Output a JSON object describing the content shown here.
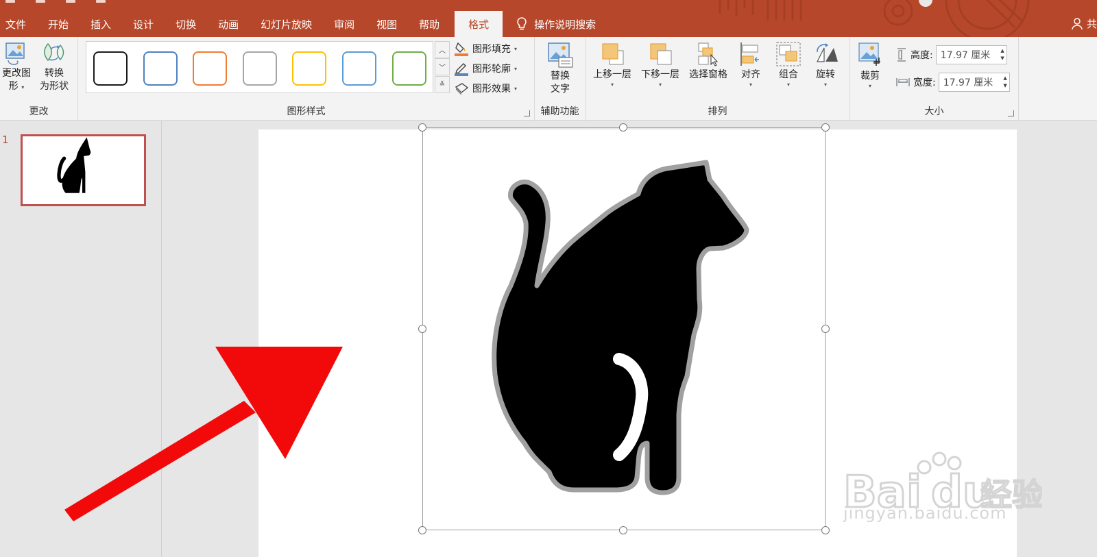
{
  "tabs": [
    "文件",
    "开始",
    "插入",
    "设计",
    "切换",
    "动画",
    "幻灯片放映",
    "审阅",
    "视图",
    "帮助",
    "格式"
  ],
  "active_tab": "格式",
  "tellme": {
    "label": "操作说明搜索"
  },
  "share": {
    "label": "共"
  },
  "ribbon": {
    "change_group": {
      "label": "更改",
      "change_shape": {
        "line1": "更改图",
        "line2": "形"
      },
      "convert": {
        "line1": "转换",
        "line2": "为形状"
      }
    },
    "shape_styles": {
      "label": "图形样式",
      "swatch_colors": [
        "#1a1a1a",
        "#4f81bd",
        "#ed7d31",
        "#a5a5a5",
        "#ffc000",
        "#5b9bd5",
        "#70ad47"
      ],
      "fill": "图形填充",
      "outline": "图形轮廓",
      "effects": "图形效果"
    },
    "accessibility": {
      "label": "辅助功能",
      "alt_text": {
        "line1": "替换",
        "line2": "文字"
      }
    },
    "arrange": {
      "label": "排列",
      "bring_forward": "上移一层",
      "send_backward": "下移一层",
      "selection_pane": "选择窗格",
      "align": "对齐",
      "group": "组合",
      "rotate": "旋转"
    },
    "size": {
      "label": "大小",
      "crop": "裁剪",
      "height_label": "高度:",
      "height_value": "17.97 厘米",
      "width_label": "宽度:",
      "width_value": "17.97 厘米"
    }
  },
  "thumbnails": [
    {
      "number": "1"
    }
  ],
  "colors": {
    "accent": "#b7472a",
    "arrow": "#f20a0a",
    "cat_fill": "#000000",
    "cat_outline": "#a0a0a0"
  },
  "watermark": {
    "text": "jingyan.baidu.com"
  }
}
